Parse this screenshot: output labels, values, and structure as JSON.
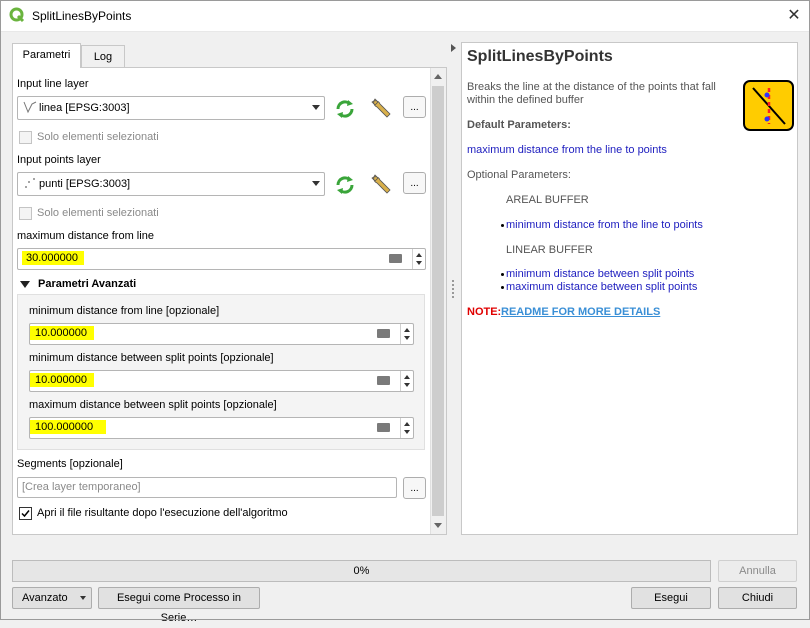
{
  "window": {
    "title": "SplitLinesByPoints",
    "close_symbol": "✕"
  },
  "tabs": [
    {
      "label": "Parametri",
      "active": true
    },
    {
      "label": "Log",
      "active": false
    }
  ],
  "params": {
    "input_line_layer_label": "Input line layer",
    "input_line_layer_value": "linea [EPSG:3003]",
    "selected_only_label": "Solo elementi selezionati",
    "input_points_layer_label": "Input points layer",
    "input_points_layer_value": "punti [EPSG:3003]",
    "max_distance_label": "maximum distance from line",
    "max_distance_value": "30.000000",
    "advanced_group_label": "Parametri Avanzati",
    "min_distance_label": "minimum distance from line [opzionale]",
    "min_distance_value": "10.000000",
    "min_split_label": "minimum distance between split points [opzionale]",
    "min_split_value": "10.000000",
    "max_split_label": "maximum distance between split points [opzionale]",
    "max_split_value": "100.000000",
    "segments_label": "Segments [opzionale]",
    "segments_placeholder": "[Crea layer temporaneo]",
    "open_result_label": "Apri il file risultante dopo l'esecuzione dell'algoritmo",
    "open_result_checked": true,
    "ellipsis": "..."
  },
  "help": {
    "title": "SplitLinesByPoints",
    "description": "Breaks the line at the distance of the points that fall within the buffered",
    "description_line1": "Breaks the line at the distance of the points that fall",
    "description_line2": "within the defined buffer",
    "default_params_heading": "Default Parameters:",
    "default_param_1": "maximum distance from the line to points",
    "optional_heading": "Optional Parameters:",
    "areal_buffer": "AREAL BUFFER",
    "areal_item_1": "minimum distance from the line to points",
    "linear_buffer": "LINEAR BUFFER",
    "linear_item_1": "minimum distance between split points",
    "linear_item_2": "maximum distance between split points",
    "note_label": "NOTE:",
    "note_link": "README FOR MORE DETAILS"
  },
  "footer": {
    "progress_text": "0%",
    "progress_value": 0,
    "cancel_label": "Annulla",
    "advanced_label": "Avanzato",
    "batch_label": "Esegui come Processo in Serie…",
    "run_label": "Esegui",
    "close_label": "Chiudi"
  },
  "colors": {
    "highlight": "#ffff00",
    "link_blue": "#1d1dbf",
    "note_red": "#e00000",
    "readme_link": "#3a8fd6",
    "qgis_green": "#6ab43e",
    "icon_yellow": "#ffcc00"
  }
}
